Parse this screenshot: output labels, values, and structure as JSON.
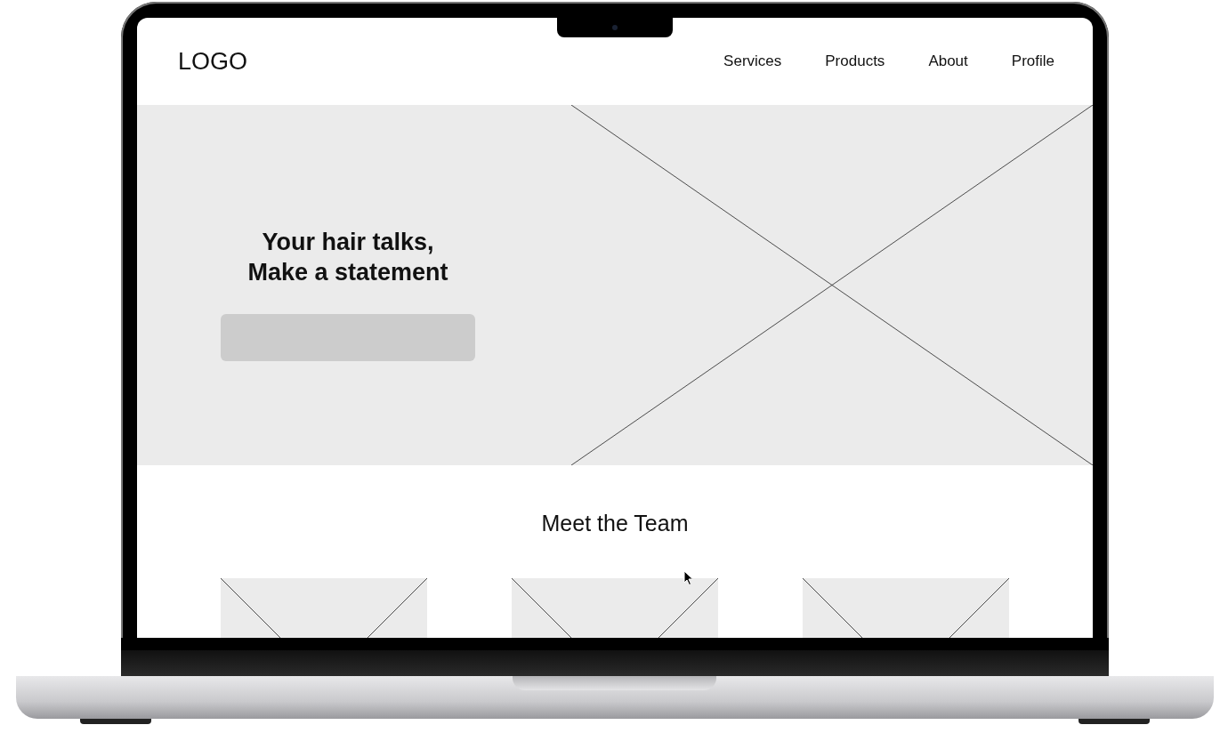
{
  "header": {
    "logo": "LOGO",
    "links": [
      {
        "label": "Services"
      },
      {
        "label": "Products"
      },
      {
        "label": "About"
      },
      {
        "label": "Profile"
      }
    ]
  },
  "hero": {
    "headline": "Your hair talks,\nMake a statement",
    "media": {
      "kind": "image-placeholder"
    }
  },
  "team": {
    "title": "Meet the Team",
    "cards": [
      {
        "kind": "image-placeholder"
      },
      {
        "kind": "image-placeholder"
      },
      {
        "kind": "image-placeholder"
      }
    ]
  }
}
